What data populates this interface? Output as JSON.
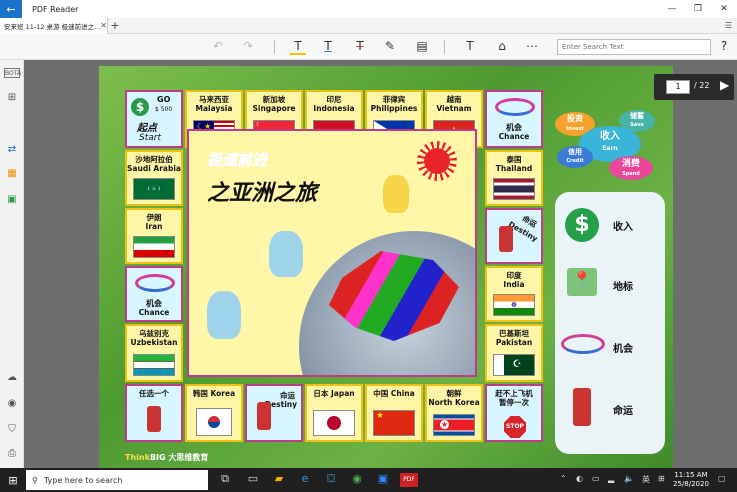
{
  "app": {
    "title": "PDF Reader"
  },
  "tab": {
    "label": "安来班 11-12 桌游 极速前进之..."
  },
  "toolbar": {
    "search_placeholder": "Enter Search Text"
  },
  "sidebar": {
    "bota_label": "BOTA"
  },
  "pager": {
    "current": "1",
    "total": "22"
  },
  "board": {
    "start": {
      "go": "GO",
      "amount": "$ 500",
      "cn": "起点",
      "en": "Start"
    },
    "center": {
      "title_cn_1": "极速前进",
      "title_cn_2": "之亚洲之旅"
    },
    "cells": {
      "malaysia": {
        "cn": "马来西亚",
        "en": "Malaysia"
      },
      "singapore": {
        "cn": "新加坡",
        "en": "Singapore"
      },
      "indonesia": {
        "cn": "印尼",
        "en": "Indonesia"
      },
      "philippines": {
        "cn": "菲律宾",
        "en": "Philippines"
      },
      "vietnam": {
        "cn": "越南",
        "en": "Vietnam"
      },
      "chance_top": {
        "cn": "机会",
        "en": "Chance"
      },
      "saudi": {
        "cn": "沙地阿拉伯",
        "en": "Saudi Arabia"
      },
      "thailand": {
        "cn": "泰国",
        "en": "Thailand"
      },
      "iran": {
        "cn": "伊朗",
        "en": "Iran"
      },
      "destiny_right": {
        "cn": "命运",
        "en": "Destiny"
      },
      "chance_left": {
        "cn": "机会",
        "en": "Chance"
      },
      "india": {
        "cn": "印度",
        "en": "India"
      },
      "uzbekistan": {
        "cn": "乌兹别克",
        "en": "Uzbekistan"
      },
      "pakistan": {
        "cn": "巴基斯坦",
        "en": "Pakistan"
      },
      "any_one": {
        "cn": "任选一个"
      },
      "korea": {
        "cn": "韩国 Korea"
      },
      "destiny_bottom": {
        "cn": "命运",
        "en": "Destiny"
      },
      "japan": {
        "cn": "日本 Japan"
      },
      "china": {
        "cn": "中国 China"
      },
      "north_korea": {
        "cn": "朝鲜",
        "en": "North Korea"
      },
      "missed_flight": {
        "cn_1": "赶不上飞机",
        "cn_2": "暂停一次",
        "stop": "STOP"
      }
    },
    "clouds": {
      "invest": {
        "cn": "投资",
        "en": "Invest"
      },
      "save": {
        "cn": "储蓄",
        "en": "Save"
      },
      "earn": {
        "cn": "收入",
        "en": "Earn"
      },
      "credit": {
        "cn": "信用",
        "en": "Credit"
      },
      "spend": {
        "cn": "消费",
        "en": "Spend"
      }
    },
    "legend": {
      "income": "收入",
      "landmark": "地标",
      "chance": "机会",
      "destiny": "命运"
    },
    "brand": {
      "think": "Think",
      "big": "BIG",
      "rest": "大思维教育"
    }
  },
  "taskbar": {
    "search_placeholder": "Type here to search",
    "language": "英",
    "time": "11:15 AM",
    "date": "25/8/2020"
  }
}
